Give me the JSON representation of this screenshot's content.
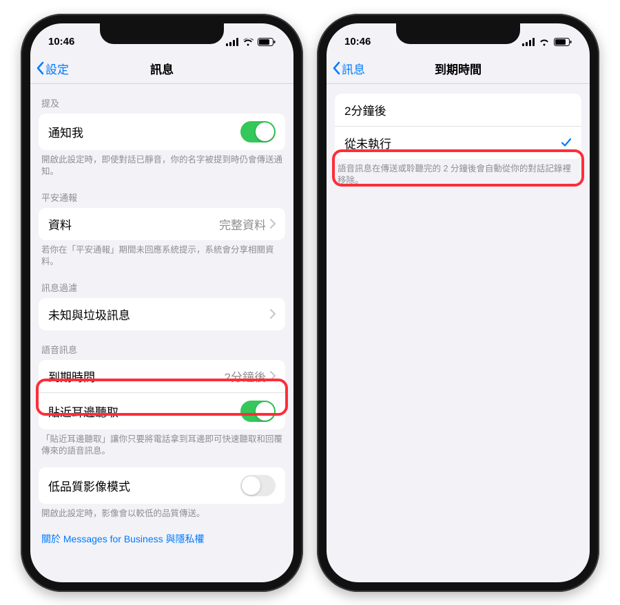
{
  "status": {
    "time": "10:46"
  },
  "left": {
    "nav": {
      "back": "設定",
      "title": "訊息"
    },
    "sections": {
      "mention": {
        "header": "提及",
        "notify_me": "通知我",
        "footer": "開啟此設定時，即使對話已靜音，你的名字被提到時仍會傳送通知。"
      },
      "safety": {
        "header": "平安通報",
        "data": "資料",
        "data_value": "完整資料",
        "footer": "若你在「平安通報」期間未回應系統提示，系統會分享相關資料。"
      },
      "filter": {
        "header": "訊息過濾",
        "unknown_spam": "未知與垃圾訊息"
      },
      "voice": {
        "header": "語音訊息",
        "expire": "到期時間",
        "expire_value": "2分鐘後",
        "raise_listen": "貼近耳邊聽取",
        "footer": "「貼近耳邊聽取」讓你只要將電話拿到耳邊即可快速聽取和回覆傳來的語音訊息。"
      },
      "quality": {
        "low_quality": "低品質影像模式",
        "footer": "開啟此設定時，影像會以較低的品質傳送。"
      },
      "about_link": "關於 Messages for Business 與隱私權"
    }
  },
  "right": {
    "nav": {
      "back": "訊息",
      "title": "到期時間"
    },
    "options": {
      "opt1": "2分鐘後",
      "opt2": "從未執行"
    },
    "footer": "語音訊息在傳送或聆聽完的 2 分鐘後會自動從你的對話記錄裡移除。"
  }
}
